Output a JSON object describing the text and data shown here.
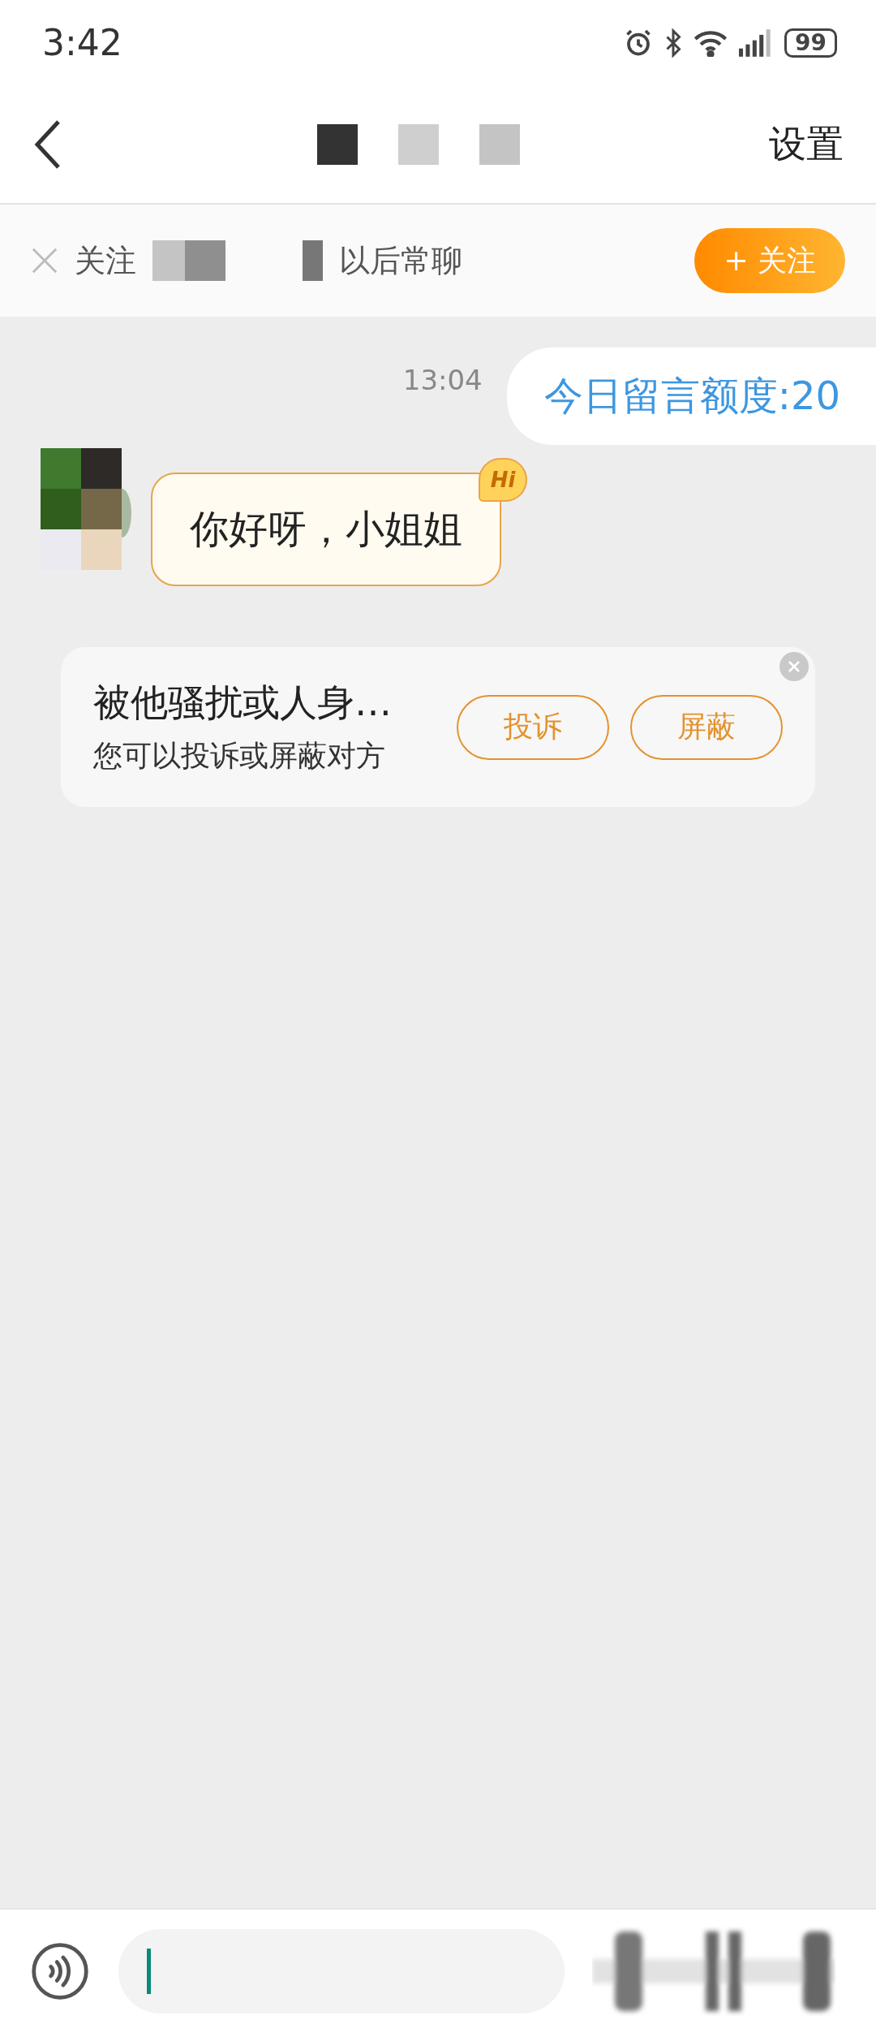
{
  "status_bar": {
    "time": "3:42",
    "battery": "99"
  },
  "header": {
    "settings": "设置"
  },
  "follow_banner": {
    "text_start": "关注",
    "text_end": "以后常聊",
    "button": "+ 关注"
  },
  "messages": [
    {
      "kind": "system",
      "time": "13:04",
      "text": "今日留言额度:20"
    },
    {
      "kind": "incoming",
      "text": "你好呀，小姐姐",
      "badge": "Hi"
    }
  ],
  "safety_card": {
    "title": "被他骚扰或人身…",
    "subtitle": "您可以投诉或屏蔽对方",
    "buttons": [
      "投诉",
      "屏蔽"
    ]
  }
}
